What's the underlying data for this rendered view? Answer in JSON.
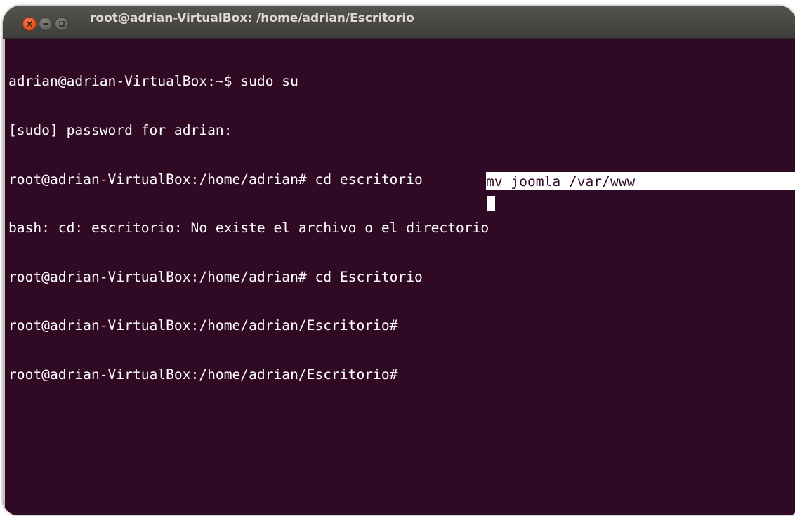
{
  "window": {
    "title": "root@adrian-VirtualBox: /home/adrian/Escritorio",
    "buttons": {
      "close": "close-icon",
      "minimize": "minimize-icon",
      "maximize": "maximize-icon"
    }
  },
  "terminal": {
    "background": "#300a24",
    "foreground": "#ffffff",
    "lines": [
      "adrian@adrian-VirtualBox:~$ sudo su",
      "[sudo] password for adrian:",
      "root@adrian-VirtualBox:/home/adrian# cd escritorio",
      "bash: cd: escritorio: No existe el archivo o el directorio",
      "root@adrian-VirtualBox:/home/adrian# cd Escritorio",
      "root@adrian-VirtualBox:/home/adrian/Escritorio# ",
      "root@adrian-VirtualBox:/home/adrian/Escritorio# "
    ],
    "selected_text": "mv joomla /var/www"
  }
}
